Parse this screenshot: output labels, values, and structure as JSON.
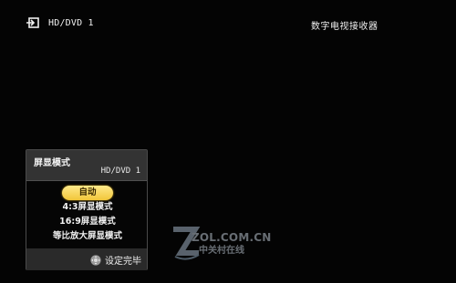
{
  "osd": {
    "source": "HD/DVD 1",
    "device": "数字电视接收器"
  },
  "menu": {
    "title": "屏显模式",
    "source": "HD/DVD 1",
    "options": [
      {
        "label": "自动",
        "selected": true
      },
      {
        "label": "4:3屏显模式",
        "selected": false
      },
      {
        "label": "16:9屏显模式",
        "selected": false
      },
      {
        "label": "等比放大屏显模式",
        "selected": false
      }
    ],
    "footer_hint": "设定完毕",
    "footer_icon": "dpad-icon"
  },
  "watermark": {
    "domain": "ZOL.COM.CN",
    "cn": "中关村在线"
  },
  "colors": {
    "background": "#040404",
    "selected_highlight": "#f1c63a",
    "panel": "#2a2a2a"
  }
}
